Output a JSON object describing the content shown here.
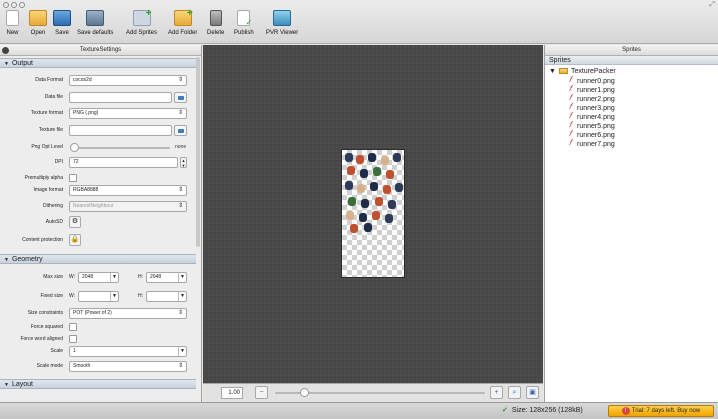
{
  "toolbar": {
    "items": [
      {
        "label": "New",
        "icon": "new-document-icon"
      },
      {
        "label": "Open",
        "icon": "open-folder-icon"
      },
      {
        "label": "Save",
        "icon": "save-disk-icon"
      },
      {
        "label": "Save defaults",
        "icon": "save-defaults-icon"
      },
      {
        "label": "Add Sprites",
        "icon": "add-sprites-icon"
      },
      {
        "label": "Add Folder",
        "icon": "add-folder-icon"
      },
      {
        "label": "Delete",
        "icon": "trash-icon"
      },
      {
        "label": "Publish",
        "icon": "publish-icon"
      },
      {
        "label": "PVR Viewer",
        "icon": "pvr-viewer-icon"
      }
    ]
  },
  "left_panel": {
    "title": "TextureSettings",
    "output": {
      "header": "Output",
      "data_format_label": "Data Format",
      "data_format_value": "cocos2d",
      "data_file_label": "Data file",
      "data_file_value": "",
      "texture_format_label": "Texture format",
      "texture_format_value": "PNG (.png)",
      "texture_file_label": "Texture file",
      "texture_file_value": "",
      "png_opt_label": "Png Opt Level",
      "png_opt_value": "none",
      "dpi_label": "DPI",
      "dpi_value": "72",
      "premultiply_label": "Premultiply alpha",
      "image_format_label": "Image format",
      "image_format_value": "RGBA8888",
      "dithering_label": "Dithering",
      "dithering_value": "NearestNeighbour",
      "autosd_label": "AutoSD",
      "content_protection_label": "Content protection"
    },
    "geometry": {
      "header": "Geometry",
      "max_size_label": "Max size",
      "max_w_key": "W:",
      "max_w_value": "2048",
      "max_h_key": "H:",
      "max_h_value": "2048",
      "fixed_size_label": "Fixed size",
      "fixed_w_key": "W:",
      "fixed_w_value": "",
      "fixed_h_key": "H:",
      "fixed_h_value": "",
      "size_constraints_label": "Size constraints",
      "size_constraints_value": "POT (Power of 2)",
      "force_squared_label": "Force squared",
      "force_word_aligned_label": "Force word aligned",
      "scale_label": "Scale",
      "scale_value": "1",
      "scale_mode_label": "Scale mode",
      "scale_mode_value": "Smooth"
    },
    "layout": {
      "header": "Layout"
    }
  },
  "canvas": {
    "zoom_value": "1.00",
    "zoom_level": 0.14
  },
  "right_panel": {
    "title": "Sprites",
    "tree_header": "Sprites",
    "folder": "TexturePacker",
    "sprites": [
      "runner0.png",
      "runner1.png",
      "runner2.png",
      "runner3.png",
      "runner4.png",
      "runner5.png",
      "runner6.png",
      "runner7.png"
    ]
  },
  "status": {
    "size_text": "Size: 128x256 (128kB)",
    "trial_text": "Trial: 7 days left. Buy now"
  },
  "colors": {
    "canvas_bg": "#474747",
    "trial_bg": "#f0a400",
    "ok_green": "#2f9d2f"
  }
}
